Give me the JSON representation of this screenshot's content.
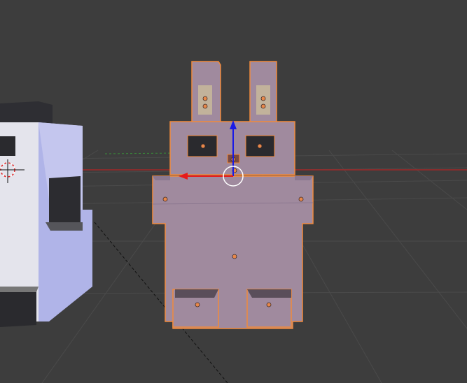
{
  "viewport": {
    "mode": "3d-view",
    "background_color": "#3d3d3d",
    "grid_color": "#4a4a4a",
    "x_axis_color": "#a02828",
    "y_axis_color": "#3a8a3a",
    "selection_outline_color": "#f08a3c",
    "selected_mesh_color": "#a08a9e",
    "unselected_mesh_color": "#d8d8e4"
  },
  "objects": [
    {
      "name": "bunny-model",
      "selected": true
    },
    {
      "name": "block-model",
      "selected": false
    }
  ],
  "manipulator": {
    "axes": [
      "z-axis-arrow",
      "x-axis-arrow"
    ],
    "z_color": "#1a1ae6",
    "x_color": "#e61a1a"
  },
  "icons": [
    "3d-cursor-icon",
    "object-origin-icon",
    "transform-manipulator-icon"
  ]
}
